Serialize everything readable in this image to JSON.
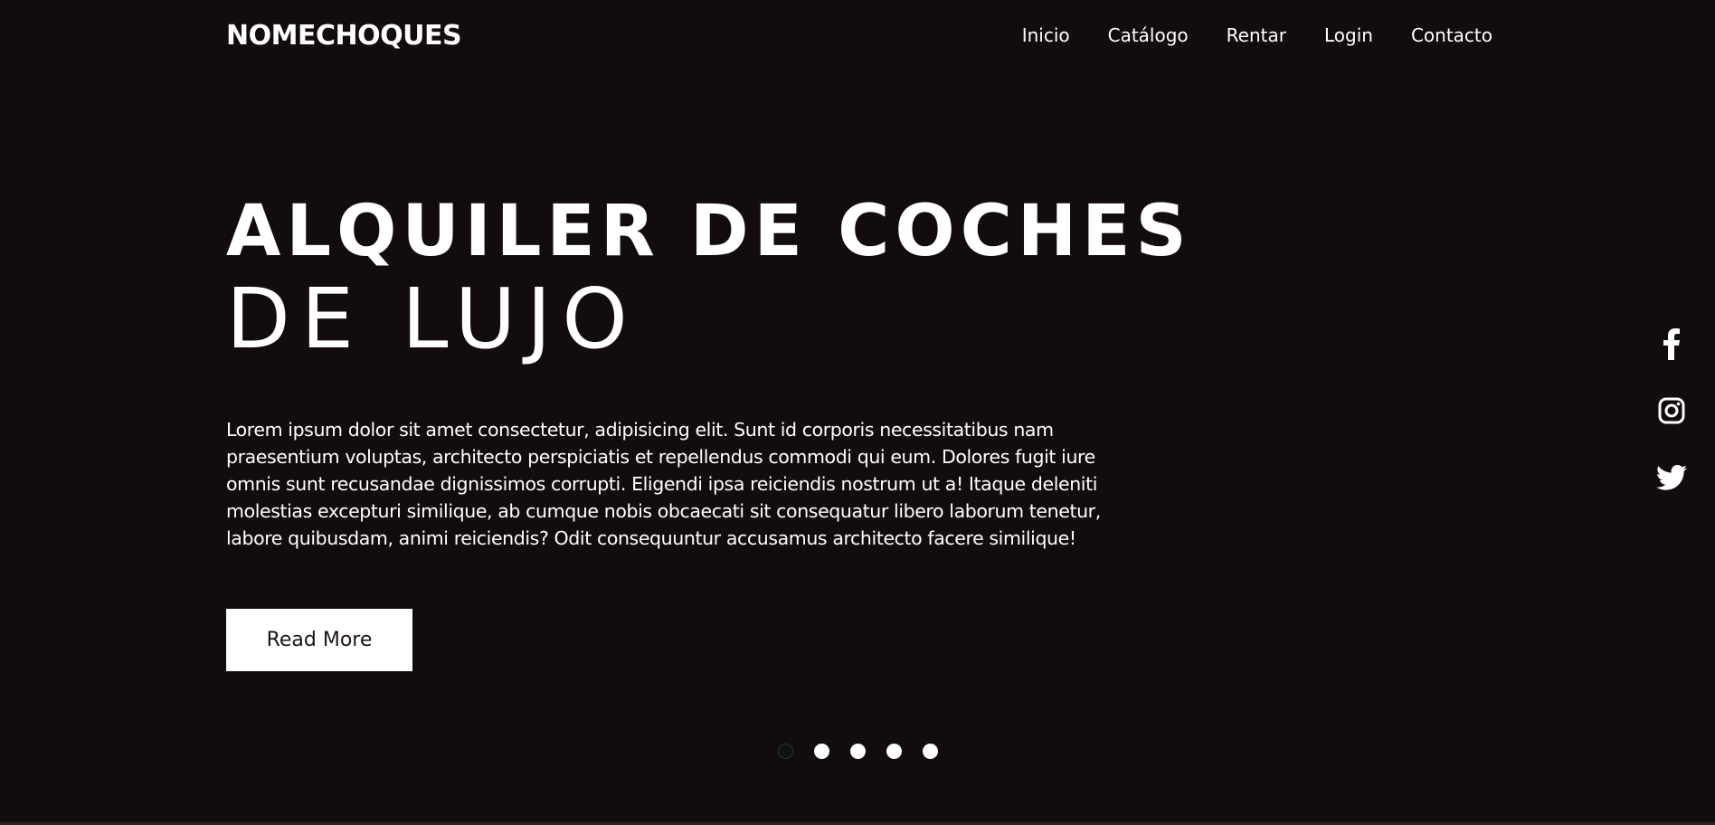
{
  "header": {
    "logo": "NOMECHOQUES",
    "nav": [
      "Inicio",
      "Catálogo",
      "Rentar",
      "Login",
      "Contacto"
    ]
  },
  "hero": {
    "title_line1": "ALQUILER DE COCHES",
    "title_line2": "DE LUJO",
    "paragraph": "Lorem ipsum dolor sit amet consectetur, adipisicing elit. Sunt id corporis necessitatibus nam praesentium voluptas, architecto perspiciatis et repellendus commodi qui eum. Dolores fugit iure omnis sunt recusandae dignissimos corrupti. Eligendi ipsa reiciendis nostrum ut a! Itaque deleniti molestias excepturi similique, ab cumque nobis obcaecati sit consequatur libero laborum tenetur, labore quibusdam, animi reiciendis? Odit consequuntur accusamus architecto facere similique!",
    "button_label": "Read More"
  },
  "slider": {
    "dot_count": 5,
    "active_index": 0
  },
  "social": [
    "facebook-icon",
    "instagram-icon",
    "twitter-icon"
  ],
  "colors": {
    "background": "#130c0c",
    "text": "#ffffff",
    "button_bg": "#ffffff",
    "button_text": "#1c1414",
    "active_dot": "#0d1212"
  }
}
